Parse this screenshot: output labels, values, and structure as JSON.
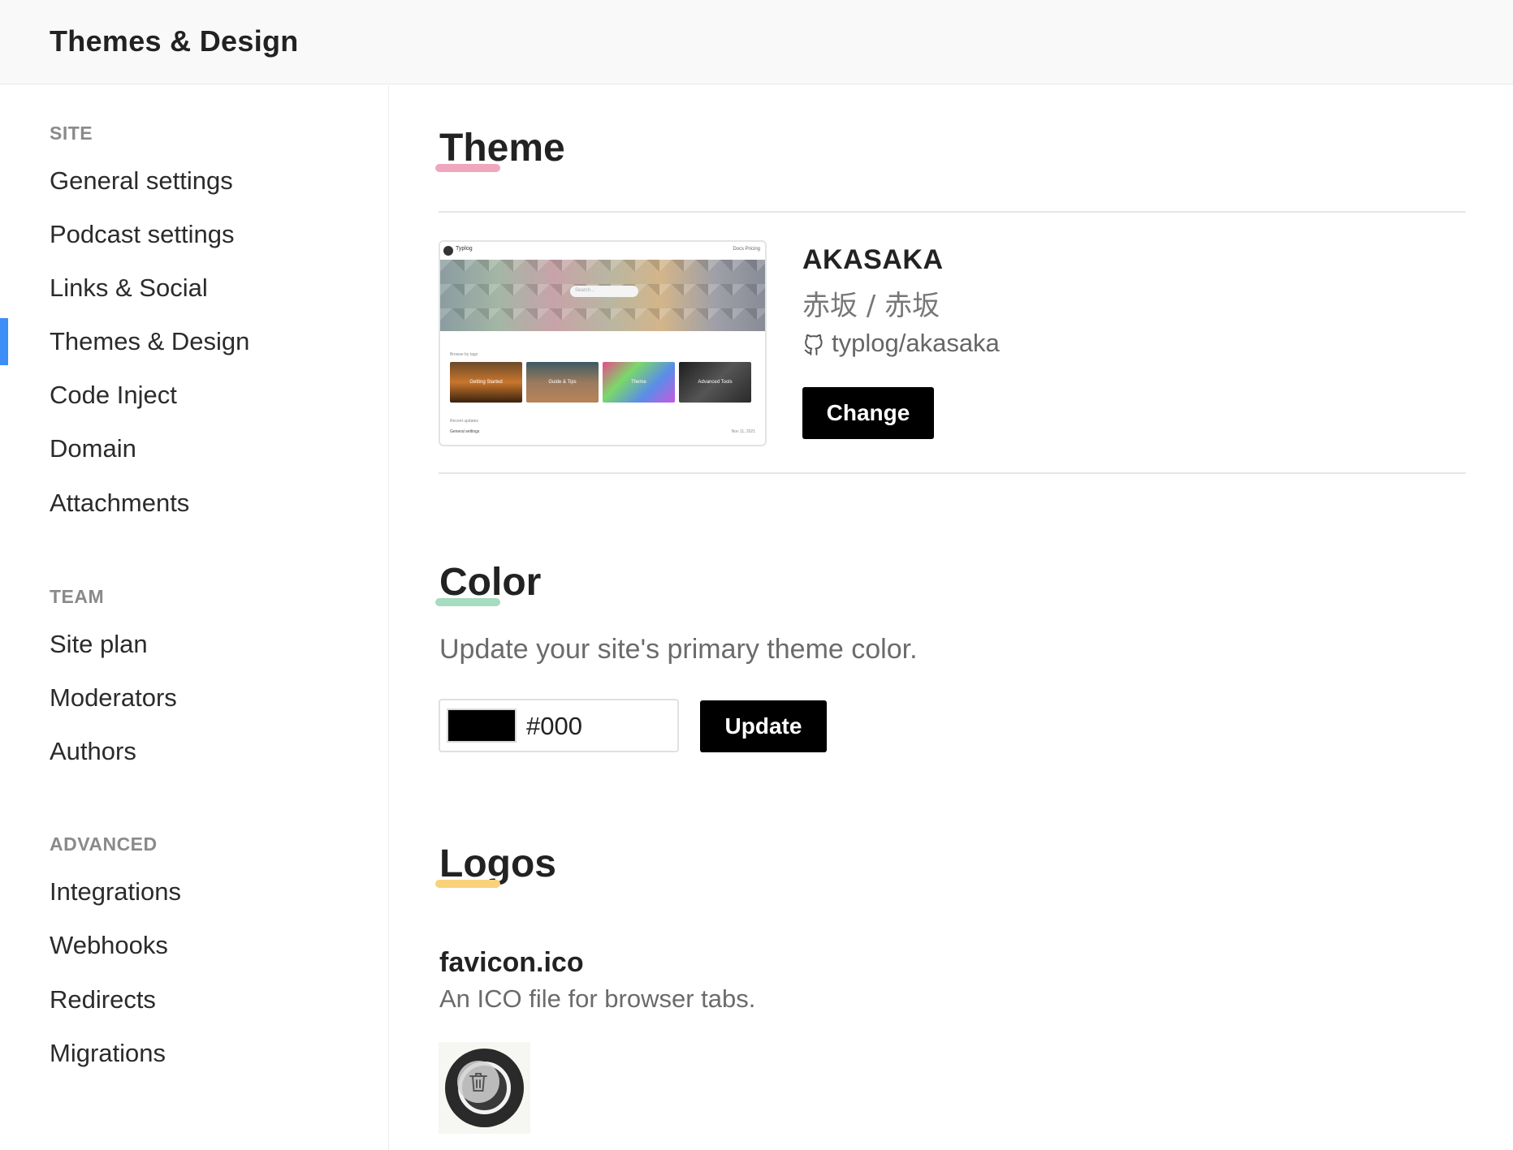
{
  "header": {
    "title": "Themes & Design"
  },
  "sidebar": {
    "sections": [
      {
        "label": "SITE",
        "items": [
          "General settings",
          "Podcast settings",
          "Links & Social",
          "Themes & Design",
          "Code Inject",
          "Domain",
          "Attachments"
        ]
      },
      {
        "label": "TEAM",
        "items": [
          "Site plan",
          "Moderators",
          "Authors"
        ]
      },
      {
        "label": "ADVANCED",
        "items": [
          "Integrations",
          "Webhooks",
          "Redirects",
          "Migrations"
        ]
      }
    ],
    "active_item": "Themes & Design",
    "accent_color": "#3d8ef7"
  },
  "theme": {
    "heading": "Theme",
    "underline_color": "#f0a7bd",
    "name": "AKASAKA",
    "subtitle": "赤坂 / 赤坂",
    "repo": "typlog/akasaka",
    "repo_icon": "github-icon",
    "change_label": "Change",
    "preview": {
      "brand": "Typlog",
      "nav_links": "Docs   Pricing",
      "search_placeholder": "Search...",
      "browse_label": "Browse by tags",
      "cards": [
        "Getting Started",
        "Guide & Tips",
        "Theme",
        "Advanced Tools"
      ],
      "recent_label": "Recent updates",
      "recent_item": "General settings",
      "recent_date": "Nov 11, 2021"
    }
  },
  "color": {
    "heading": "Color",
    "underline_color": "#a6dcc0",
    "description": "Update your site's primary theme color.",
    "value": "#000",
    "swatch_color": "#000000",
    "update_label": "Update"
  },
  "logos": {
    "heading": "Logos",
    "underline_color": "#f9d27a",
    "favicon": {
      "title": "favicon.ico",
      "description": "An ICO file for browser tabs.",
      "delete_icon": "trash-icon"
    }
  }
}
